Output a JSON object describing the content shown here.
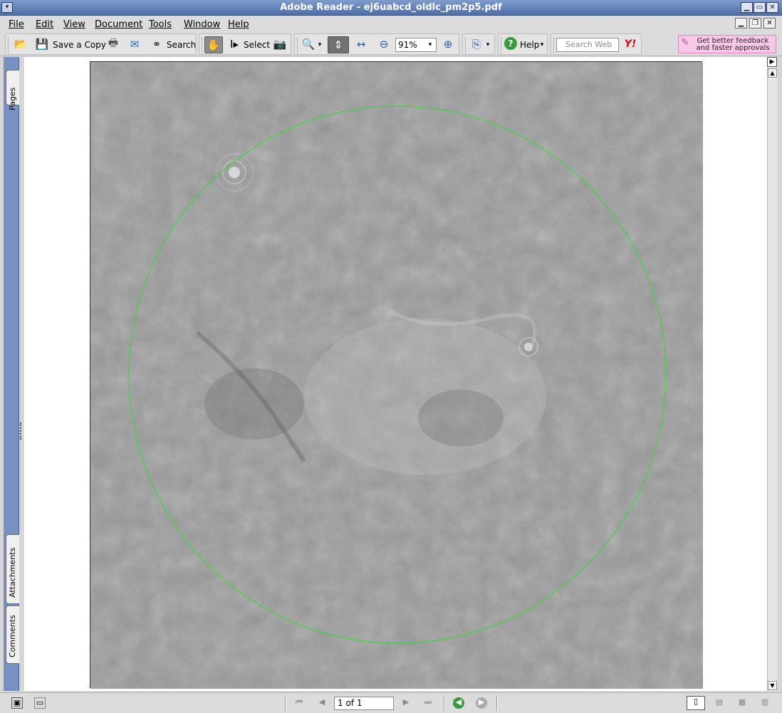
{
  "window": {
    "title": "Adobe Reader - ej6uabcd_oldlc_pm2p5.pdf",
    "controls": [
      "minimize",
      "maximize",
      "close"
    ]
  },
  "menubar": {
    "items": [
      {
        "label": "File"
      },
      {
        "label": "Edit"
      },
      {
        "label": "View"
      },
      {
        "label": "Document"
      },
      {
        "label": "Tools"
      },
      {
        "label": "Window"
      },
      {
        "label": "Help"
      }
    ]
  },
  "toolbar": {
    "save_copy_label": "Save a Copy",
    "search_label": "Search",
    "select_label": "Select",
    "zoom_value": "91%",
    "help_label": "Help",
    "search_web_placeholder": "Search Web",
    "promo_text": "Get better feedback and faster approvals"
  },
  "navpanel": {
    "tabs": [
      "Pages",
      "Attachments",
      "Comments"
    ]
  },
  "statusbar": {
    "page_indicator": "1 of 1"
  },
  "colors": {
    "titlebar": "#5f7fb5",
    "navpanel": "#7891c3",
    "circle": "#3fd43f",
    "promo": "#f8c8e8"
  },
  "icons": [
    "open-folder-icon",
    "save-icon",
    "print-icon",
    "email-icon",
    "binoculars-icon",
    "hand-tool-icon",
    "select-text-icon",
    "snapshot-icon",
    "zoom-in-icon",
    "fit-page-icon",
    "fit-width-icon",
    "zoom-out-minus-icon",
    "zoom-in-plus-icon",
    "rotate-view-icon",
    "help-icon",
    "yahoo-icon",
    "first-page-icon",
    "previous-page-icon",
    "next-page-icon",
    "last-page-icon",
    "go-back-icon",
    "go-forward-icon"
  ]
}
